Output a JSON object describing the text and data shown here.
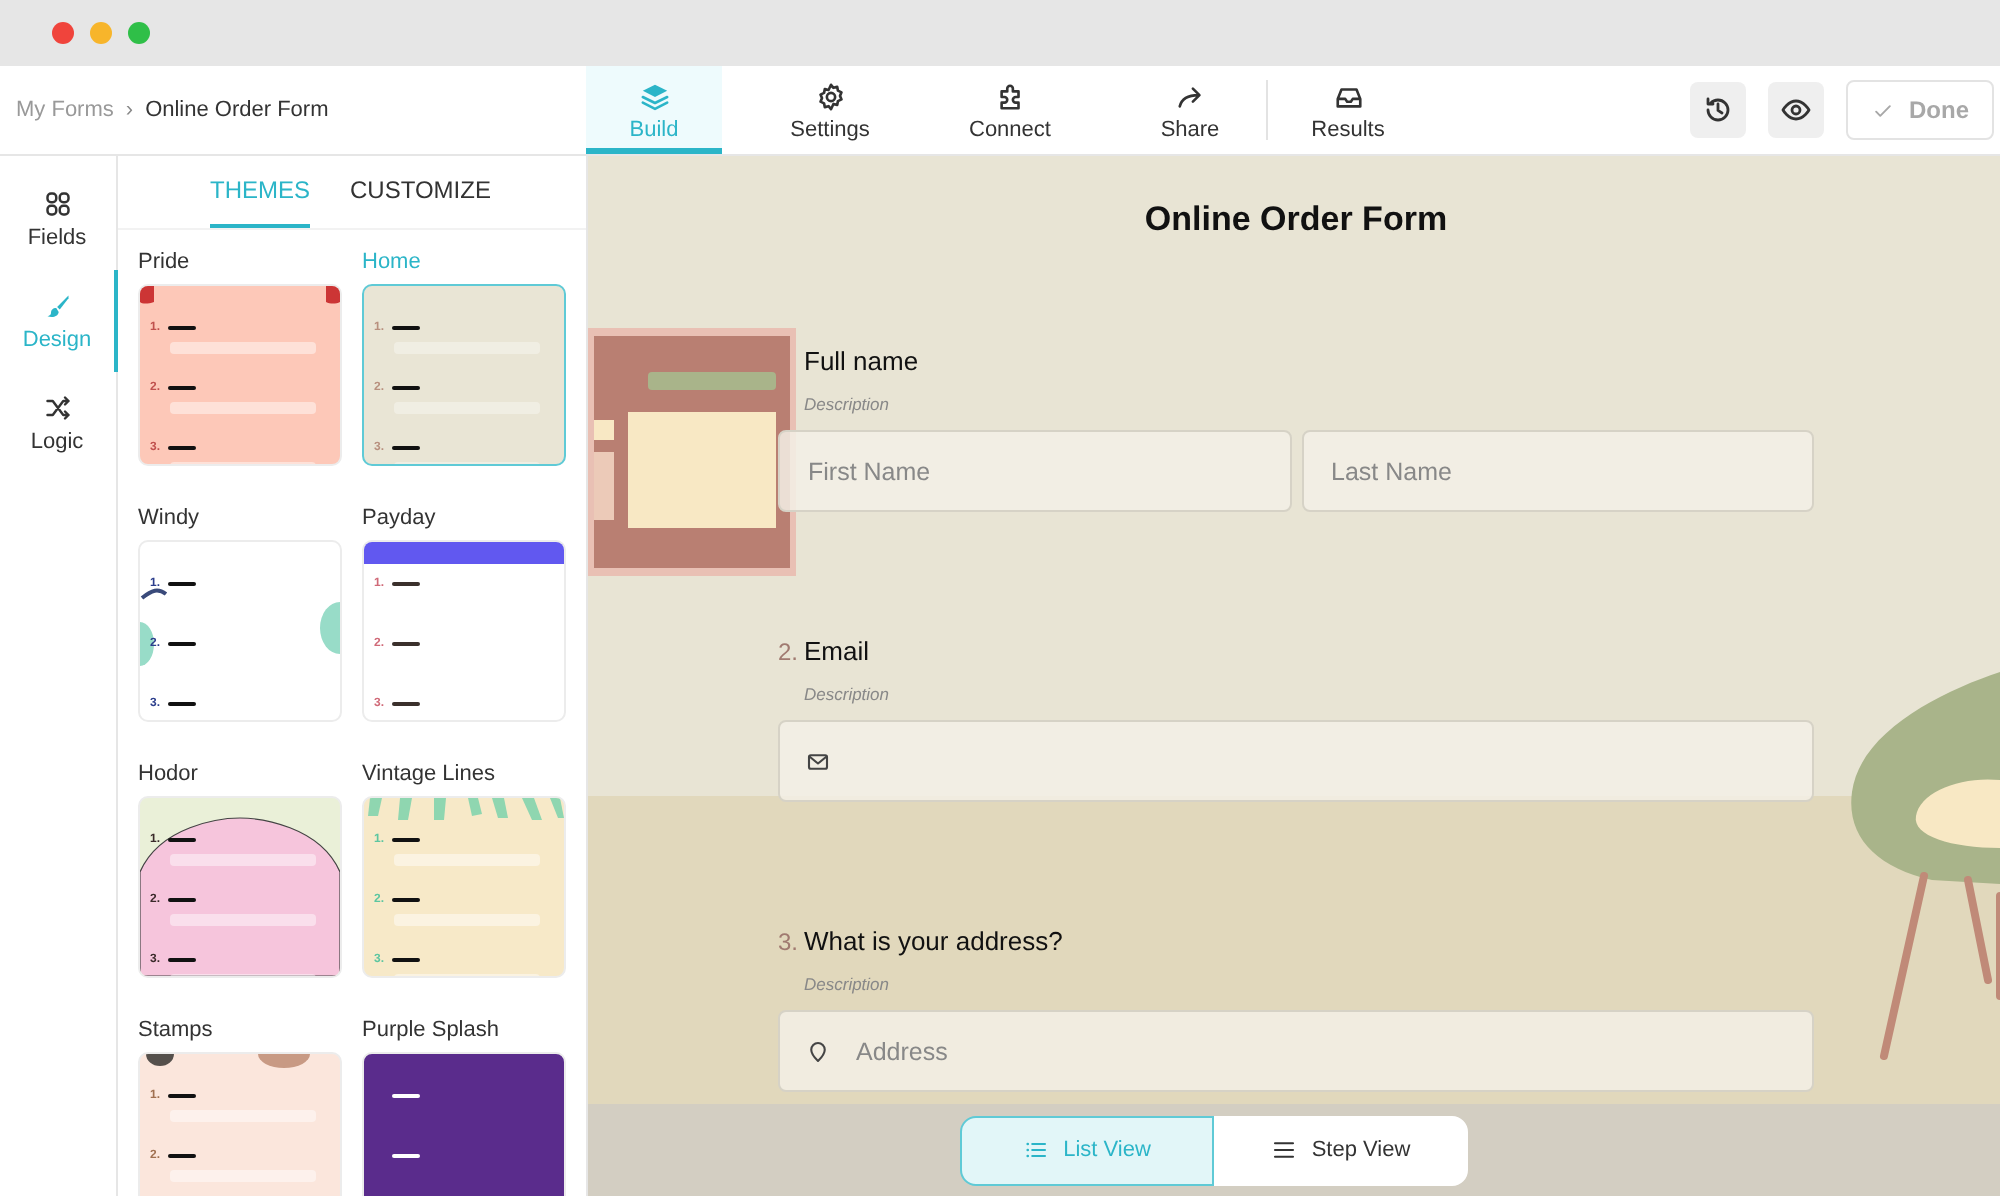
{
  "breadcrumb": {
    "items": [
      "My Forms",
      "Online Order Form"
    ],
    "separator": "›"
  },
  "nav_tabs": [
    {
      "label": "Build",
      "kind": "build",
      "selected": true,
      "separated": false
    },
    {
      "label": "Settings",
      "kind": "settings",
      "selected": false,
      "separated": false
    },
    {
      "label": "Connect",
      "kind": "connect",
      "selected": false,
      "separated": false
    },
    {
      "label": "Share",
      "kind": "share",
      "selected": false,
      "separated": false
    },
    {
      "label": "Results",
      "kind": "results",
      "selected": false,
      "separated": true
    }
  ],
  "header_actions": [
    {
      "kind": "history"
    },
    {
      "kind": "preview"
    }
  ],
  "done_button": {
    "label": "Done",
    "disabled": true
  },
  "sidebar": {
    "items": [
      {
        "label": "Fields",
        "kind": "fields",
        "selected": false
      },
      {
        "label": "Design",
        "kind": "design",
        "selected": true
      },
      {
        "label": "Logic",
        "kind": "logic",
        "selected": false
      }
    ]
  },
  "theme_panel": {
    "tabs": [
      {
        "label": "THEMES",
        "selected": true
      },
      {
        "label": "CUSTOMIZE",
        "selected": false
      }
    ],
    "themes": [
      {
        "name": "Pride",
        "kind": "pride",
        "selected": false,
        "markers": [
          "1.",
          "2.",
          "3."
        ]
      },
      {
        "name": "Home",
        "kind": "home",
        "selected": true,
        "markers": [
          "1.",
          "2.",
          "3."
        ]
      },
      {
        "name": "Windy",
        "kind": "windy",
        "selected": false,
        "markers": [
          "1.",
          "2.",
          "3."
        ]
      },
      {
        "name": "Payday",
        "kind": "payday",
        "selected": false,
        "markers": [
          "1.",
          "2.",
          "3."
        ]
      },
      {
        "name": "Hodor",
        "kind": "hodor",
        "selected": false,
        "markers": [
          "1.",
          "2.",
          "3."
        ]
      },
      {
        "name": "Vintage Lines",
        "kind": "vintage",
        "selected": false,
        "markers": [
          "1.",
          "2.",
          "3."
        ]
      },
      {
        "name": "Stamps",
        "kind": "stamps",
        "selected": false,
        "markers": [
          "1.",
          "2."
        ]
      },
      {
        "name": "Purple Splash",
        "kind": "purple",
        "selected": false
      }
    ]
  },
  "form": {
    "title": "Online Order Form",
    "questions": [
      {
        "label": "Full name",
        "description": "Description",
        "inputs": [
          {
            "kind": "text",
            "placeholder": "First Name"
          },
          {
            "kind": "text",
            "placeholder": "Last Name"
          }
        ]
      },
      {
        "number": "2.",
        "label": "Email",
        "description": "Description",
        "inputs": [
          {
            "kind": "email"
          }
        ]
      },
      {
        "number": "3.",
        "label": "What is your address?",
        "description": "Description",
        "inputs": [
          {
            "kind": "address",
            "placeholder": "Address"
          }
        ]
      }
    ]
  },
  "view_toggle": [
    {
      "label": "List View",
      "kind": "list",
      "selected": true
    },
    {
      "label": "Step View",
      "kind": "step",
      "selected": false
    }
  ]
}
